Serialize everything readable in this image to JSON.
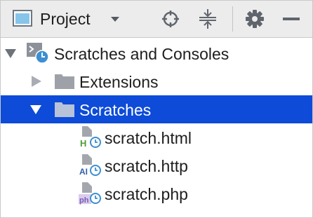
{
  "toolbar": {
    "title": "Project",
    "icons": {
      "view": "project-view-icon",
      "dropdown": "dropdown-arrow-icon",
      "locate": "locate-crosshair-icon",
      "collapse": "collapse-all-icon",
      "settings": "gear-icon",
      "hide": "minimize-icon"
    }
  },
  "tree": {
    "root": {
      "label": "Scratches and Consoles",
      "expanded": true,
      "icon": "scratches-consoles-icon"
    },
    "folders": [
      {
        "label": "Extensions",
        "expanded": false,
        "icon": "folder-icon"
      },
      {
        "label": "Scratches",
        "expanded": true,
        "selected": true,
        "icon": "folder-icon"
      }
    ],
    "files": [
      {
        "label": "scratch.html",
        "badge": "H",
        "icon": "html-scratch-file-icon"
      },
      {
        "label": "scratch.http",
        "badge": "API",
        "icon": "http-scratch-file-icon"
      },
      {
        "label": "scratch.php",
        "badge": "php",
        "icon": "php-scratch-file-icon"
      }
    ]
  },
  "colors": {
    "selection": "#0d4bd8",
    "toolbar_bg": "#ececec",
    "folder": "#9ea2a8",
    "clock": "#3d8fd1",
    "html_badge": "#4f9d3a",
    "http_badge": "#2f5fa8",
    "php_badge": "#7d5bb2"
  }
}
